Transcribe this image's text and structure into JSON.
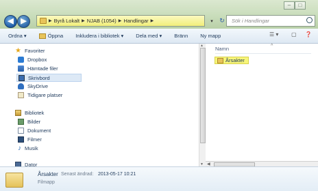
{
  "window": {
    "minimize_label": "–",
    "maximize_label": "□",
    "close_label": "✕"
  },
  "nav": {
    "back_glyph": "◀",
    "forward_glyph": "▶"
  },
  "address": {
    "crumbs": [
      "Byrå Lokalt",
      "NJAB (1054)",
      "Handlingar"
    ]
  },
  "search": {
    "placeholder": "Sök i Handlingar"
  },
  "toolbar": {
    "organize": "Ordna ▾",
    "open": "Öppna",
    "include": "Inkludera i bibliotek ▾",
    "share": "Dela med ▾",
    "burn": "Bränn",
    "new_folder": "Ny mapp"
  },
  "sidebar": {
    "favorites": "Favoriter",
    "dropbox": "Dropbox",
    "downloads": "Hämtade filer",
    "desktop": "Skrivbord",
    "skydrive": "SkyDrive",
    "recent": "Tidigare platser",
    "libraries": "Bibliotek",
    "pictures": "Bilder",
    "documents": "Dokument",
    "videos": "Filmer",
    "music": "Musik",
    "computer": "Dator"
  },
  "content": {
    "column_name": "Namn",
    "items": [
      {
        "name": "Årsakter"
      }
    ]
  },
  "details": {
    "name": "Årsakter",
    "modified_label": "Senast ändrad:",
    "modified_value": "2013-05-17 10:21",
    "type": "Filmapp"
  }
}
